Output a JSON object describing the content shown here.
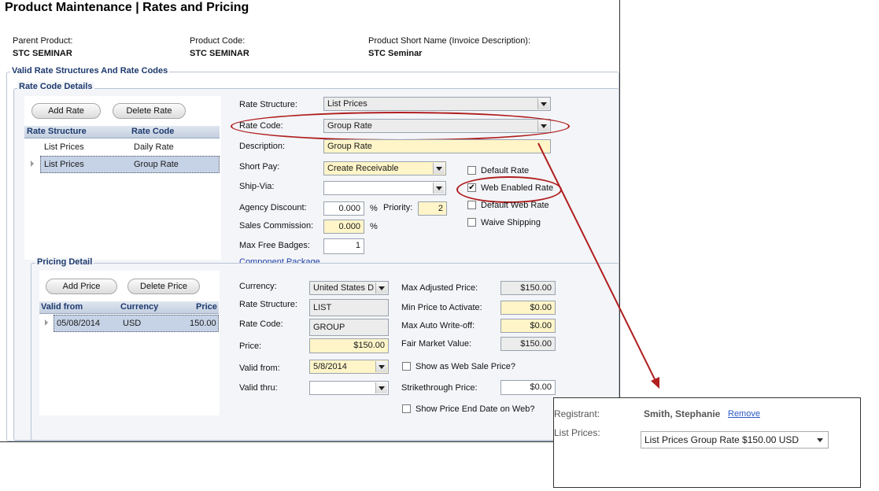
{
  "header": {
    "title": "Product Maintenance  |  Rates and Pricing"
  },
  "product": {
    "parent_label": "Parent Product:",
    "parent_value": "STC SEMINAR",
    "code_label": "Product Code:",
    "code_value": "STC SEMINAR",
    "short_name_label": "Product Short Name (Invoice Description):",
    "short_name_value": "STC Seminar"
  },
  "groups": {
    "valid_rate": "Valid Rate Structures And Rate Codes",
    "rate_code_details": "Rate Code Details",
    "pricing_detail": "Pricing Detail"
  },
  "rate_grid": {
    "add_label": "Add Rate",
    "delete_label": "Delete Rate",
    "headers": [
      "Rate Structure",
      "Rate Code"
    ],
    "rows": [
      [
        "List Prices",
        "Daily Rate"
      ],
      [
        "List Prices",
        "Group Rate"
      ]
    ]
  },
  "rate_form": {
    "structure_label": "Rate Structure:",
    "structure_value": "List Prices",
    "code_label": "Rate Code:",
    "code_value": "Group Rate",
    "description_label": "Description:",
    "description_value": "Group Rate",
    "short_pay_label": "Short Pay:",
    "short_pay_value": "Create Receivable",
    "ship_via_label": "Ship-Via:",
    "ship_via_value": "",
    "agency_label": "Agency Discount:",
    "agency_value": "0.000",
    "percent": "%",
    "priority_label": "Priority:",
    "priority_value": "2",
    "sales_label": "Sales Commission:",
    "sales_value": "0.000",
    "badges_label": "Max Free Badges:",
    "badges_value": "1",
    "component_link": "Component Package",
    "default_rate": "Default Rate",
    "web_enabled": "Web Enabled Rate",
    "default_web": "Default Web Rate",
    "waive_shipping": "Waive Shipping",
    "check_mark": "✔"
  },
  "price_grid": {
    "add_label": "Add Price",
    "delete_label": "Delete Price",
    "headers": [
      "Valid from",
      "Currency",
      "Price"
    ],
    "rows": [
      [
        "05/08/2014",
        "USD",
        "150.00"
      ]
    ]
  },
  "price_form": {
    "currency_label": "Currency:",
    "currency_value": "United States D",
    "structure_label": "Rate Structure:",
    "structure_value": "LIST",
    "code_label": "Rate Code:",
    "code_value": "GROUP",
    "price_label": "Price:",
    "price_value": "$150.00",
    "valid_from_label": "Valid from:",
    "valid_from_value": "5/8/2014",
    "valid_thru_label": "Valid thru:",
    "valid_thru_value": "",
    "max_adj_label": "Max Adjusted Price:",
    "max_adj_value": "$150.00",
    "min_price_label": "Min Price to Activate:",
    "min_price_value": "$0.00",
    "max_write_label": "Max Auto Write-off:",
    "max_write_value": "$0.00",
    "fair_label": "Fair Market Value:",
    "fair_value": "$150.00",
    "web_sale_label": "Show as Web Sale Price?",
    "strike_label": "Strikethrough Price:",
    "strike_value": "$0.00",
    "end_date_label": "Show Price End Date on Web?"
  },
  "web_preview": {
    "registrant_label": "Registrant:",
    "registrant_value": "Smith, Stephanie",
    "remove_link": "Remove",
    "list_label": "List Prices:",
    "list_value": "List Prices Group Rate $150.00 USD"
  },
  "colors": {
    "annotation": "#b01e1e",
    "group_title": "#1d3a6e",
    "required_bg": "#fff5c8"
  }
}
